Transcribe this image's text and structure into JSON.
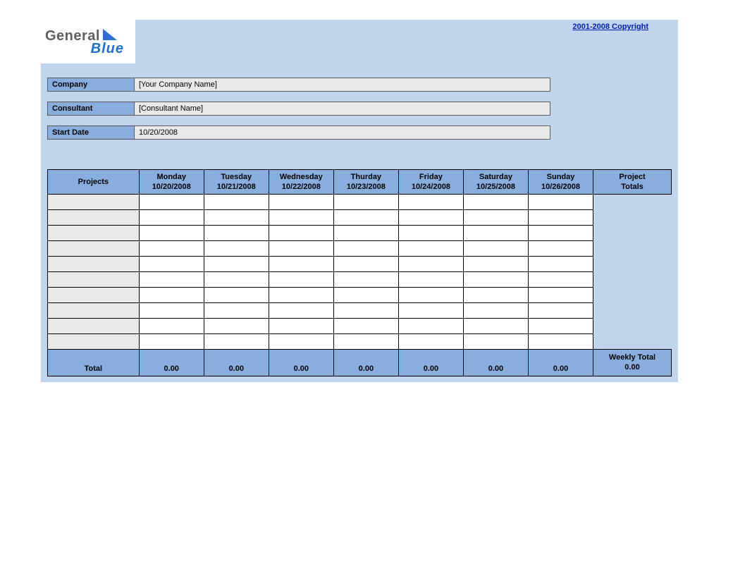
{
  "logo": {
    "line1": "General",
    "line2": "Blue"
  },
  "copyright_text": "2001-2008 Copyright",
  "meta": {
    "company_label": "Company",
    "company_value": "[Your Company Name]",
    "consultant_label": "Consultant",
    "consultant_value": "[Consultant Name]",
    "startdate_label": "Start Date",
    "startdate_value": "10/20/2008"
  },
  "columns": {
    "projects": "Projects",
    "days": [
      {
        "name": "Monday",
        "date": "10/20/2008"
      },
      {
        "name": "Tuesday",
        "date": "10/21/2008"
      },
      {
        "name": "Wednesday",
        "date": "10/22/2008"
      },
      {
        "name": "Thurday",
        "date": "10/23/2008"
      },
      {
        "name": "Friday",
        "date": "10/24/2008"
      },
      {
        "name": "Saturday",
        "date": "10/25/2008"
      },
      {
        "name": "Sunday",
        "date": "10/26/2008"
      }
    ],
    "project_totals_l1": "Project",
    "project_totals_l2": "Totals"
  },
  "rows": [
    {
      "project": "",
      "cells": [
        "",
        "",
        "",
        "",
        "",
        "",
        ""
      ],
      "total": ""
    },
    {
      "project": "",
      "cells": [
        "",
        "",
        "",
        "",
        "",
        "",
        ""
      ],
      "total": ""
    },
    {
      "project": "",
      "cells": [
        "",
        "",
        "",
        "",
        "",
        "",
        ""
      ],
      "total": ""
    },
    {
      "project": "",
      "cells": [
        "",
        "",
        "",
        "",
        "",
        "",
        ""
      ],
      "total": ""
    },
    {
      "project": "",
      "cells": [
        "",
        "",
        "",
        "",
        "",
        "",
        ""
      ],
      "total": ""
    },
    {
      "project": "",
      "cells": [
        "",
        "",
        "",
        "",
        "",
        "",
        ""
      ],
      "total": ""
    },
    {
      "project": "",
      "cells": [
        "",
        "",
        "",
        "",
        "",
        "",
        ""
      ],
      "total": ""
    },
    {
      "project": "",
      "cells": [
        "",
        "",
        "",
        "",
        "",
        "",
        ""
      ],
      "total": ""
    },
    {
      "project": "",
      "cells": [
        "",
        "",
        "",
        "",
        "",
        "",
        ""
      ],
      "total": ""
    },
    {
      "project": "",
      "cells": [
        "",
        "",
        "",
        "",
        "",
        "",
        ""
      ],
      "total": ""
    }
  ],
  "totals": {
    "label": "Total",
    "day_totals": [
      "0.00",
      "0.00",
      "0.00",
      "0.00",
      "0.00",
      "0.00",
      "0.00"
    ],
    "weekly_label": "Weekly Total",
    "weekly_value": "0.00"
  }
}
